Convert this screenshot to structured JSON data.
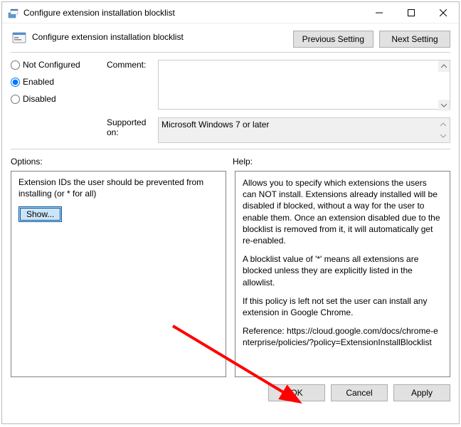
{
  "titlebar": {
    "title": "Configure extension installation blocklist"
  },
  "header": {
    "title": "Configure extension installation blocklist",
    "previous_label": "Previous Setting",
    "next_label": "Next Setting"
  },
  "config": {
    "radios": {
      "not_configured": "Not Configured",
      "enabled": "Enabled",
      "disabled": "Disabled",
      "selected": "enabled"
    },
    "comment_label": "Comment:",
    "comment_value": "",
    "supported_label": "Supported on:",
    "supported_value": "Microsoft Windows 7 or later"
  },
  "lower": {
    "options_label": "Options:",
    "help_label": "Help:",
    "options_text": "Extension IDs the user should be prevented from installing (or * for all)",
    "show_button": "Show...",
    "help_paragraphs": [
      "Allows you to specify which extensions the users can NOT install. Extensions already installed will be disabled if blocked, without a way for the user to enable them. Once an extension disabled due to the blocklist is removed from it, it will automatically get re-enabled.",
      "A blocklist value of '*' means all extensions are blocked unless they are explicitly listed in the allowlist.",
      "If this policy is left not set the user can install any extension in Google Chrome.",
      "Reference: https://cloud.google.com/docs/chrome-enterprise/policies/?policy=ExtensionInstallBlocklist"
    ]
  },
  "footer": {
    "ok": "OK",
    "cancel": "Cancel",
    "apply": "Apply"
  }
}
